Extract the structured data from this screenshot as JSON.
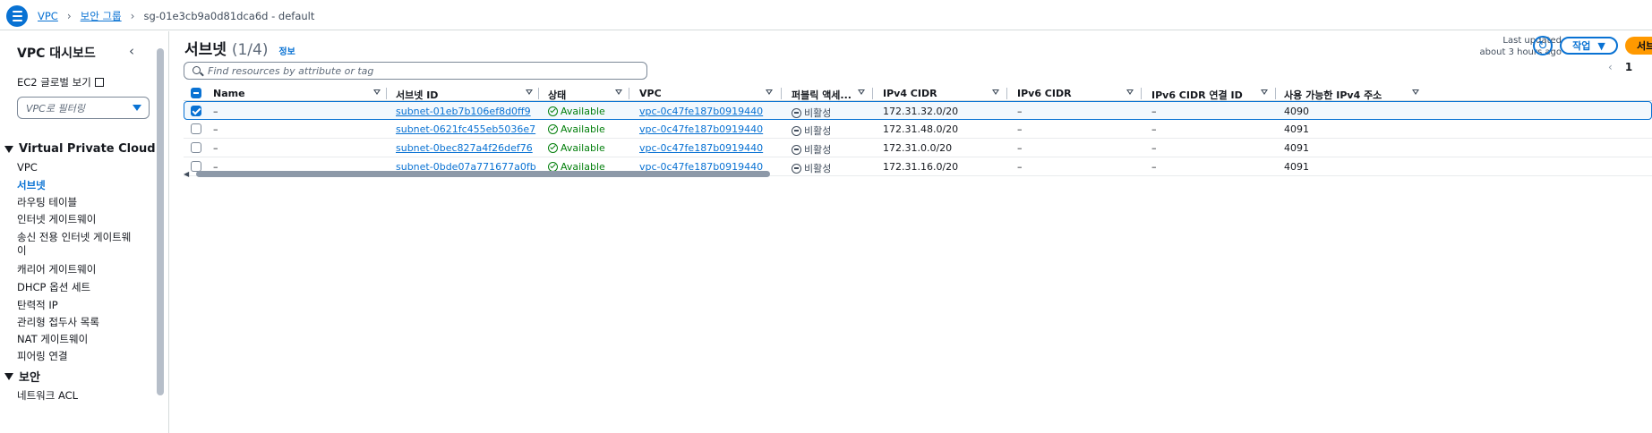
{
  "breadcrumb": {
    "items": [
      "VPC",
      "보안 그룹"
    ],
    "current": "sg-01e3cb9a0d81dca6d - default"
  },
  "sidebar": {
    "title": "VPC 대시보드",
    "ec2_link": "EC2 글로벌 보기",
    "filter_placeholder": "VPC로 필터링",
    "section_vpc": "Virtual Private Cloud",
    "items": [
      "VPC",
      "서브넷",
      "라우팅 테이블",
      "인터넷 게이트웨이",
      "송신 전용 인터넷 게이트웨",
      "이",
      "캐리어 게이트웨이",
      "DHCP 옵션 세트",
      "탄력적 IP",
      "관리형 접두사 목록",
      "NAT 게이트웨이",
      "피어링 연결"
    ],
    "section_security": "보안",
    "security_items": [
      "네트워크 ACL"
    ]
  },
  "main": {
    "title": "서브넷",
    "count": "(1/4)",
    "info": "정보",
    "last_updated_label": "Last updated",
    "last_updated_value": "about 3 hours ago",
    "action_label": "작업",
    "create_label": "서브",
    "search_placeholder": "Find resources by attribute or tag",
    "page_number": "1"
  },
  "table": {
    "headers": [
      "Name",
      "서브넷 ID",
      "상태",
      "VPC",
      "퍼블릭 액세...",
      "IPv4 CIDR",
      "IPv6 CIDR",
      "IPv6 CIDR 연결 ID",
      "사용 가능한 IPv4 주소"
    ],
    "rows": [
      {
        "selected": true,
        "name": "–",
        "subnet_id": "subnet-01eb7b106ef8d0ff9",
        "state": "Available",
        "vpc": "vpc-0c47fe187b0919440",
        "public": "비활성",
        "ipv4": "172.31.32.0/20",
        "ipv6": "–",
        "ipv6_assoc": "–",
        "available": "4090"
      },
      {
        "selected": false,
        "name": "–",
        "subnet_id": "subnet-0621fc455eb5036e7",
        "state": "Available",
        "vpc": "vpc-0c47fe187b0919440",
        "public": "비활성",
        "ipv4": "172.31.48.0/20",
        "ipv6": "–",
        "ipv6_assoc": "–",
        "available": "4091"
      },
      {
        "selected": false,
        "name": "–",
        "subnet_id": "subnet-0bec827a4f26def76",
        "state": "Available",
        "vpc": "vpc-0c47fe187b0919440",
        "public": "비활성",
        "ipv4": "172.31.0.0/20",
        "ipv6": "–",
        "ipv6_assoc": "–",
        "available": "4091"
      },
      {
        "selected": false,
        "name": "–",
        "subnet_id": "subnet-0bde07a771677a0fb",
        "state": "Available",
        "vpc": "vpc-0c47fe187b0919440",
        "public": "비활성",
        "ipv4": "172.31.16.0/20",
        "ipv6": "–",
        "ipv6_assoc": "–",
        "available": "4091"
      }
    ]
  },
  "colors": {
    "accent": "#0972d3",
    "success": "#037f0c",
    "primary_button": "#ff9900"
  }
}
